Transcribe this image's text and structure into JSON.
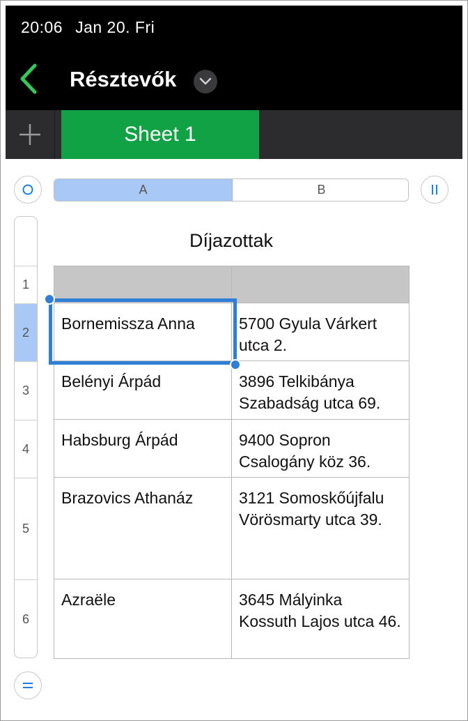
{
  "status_bar": {
    "time": "20:06",
    "date": "Jan 20. Fri"
  },
  "nav": {
    "back_icon": "chevron-left-icon",
    "title": "Résztevők",
    "title_menu_icon": "chevron-down-icon"
  },
  "tabs": {
    "add_icon": "plus-icon",
    "sheets": [
      {
        "label": "Sheet 1",
        "active": true
      }
    ]
  },
  "column_headers": [
    "A",
    "B"
  ],
  "select_all_icon": "circle-icon",
  "freeze_columns_icon": "pause-bars-icon",
  "freeze_rows_icon": "equals-icon",
  "row_numbers": [
    "1",
    "2",
    "3",
    "4",
    "5",
    "6"
  ],
  "selected_row": "2",
  "table": {
    "title": "Díjazottak",
    "header": [
      "",
      ""
    ],
    "rows": [
      [
        "Bornemissza Anna",
        "5700 Gyula Várkert utca 2."
      ],
      [
        "Belényi Árpád",
        "3896 Telkibánya Szabadság utca 69."
      ],
      [
        "Habsburg Árpád",
        "9400 Sopron Csalogány köz 36."
      ],
      [
        "Brazovics Athanáz",
        "3121 Somoskőújfalu Vörösmarty utca 39."
      ],
      [
        "Azraële",
        "3645 Mályinka Kossuth Lajos utca 46."
      ]
    ]
  },
  "colors": {
    "accent": "#2f7fd6",
    "sheet_tab": "#11a246",
    "back_arrow": "#34c759",
    "selection_fill": "#a8c8f5"
  }
}
